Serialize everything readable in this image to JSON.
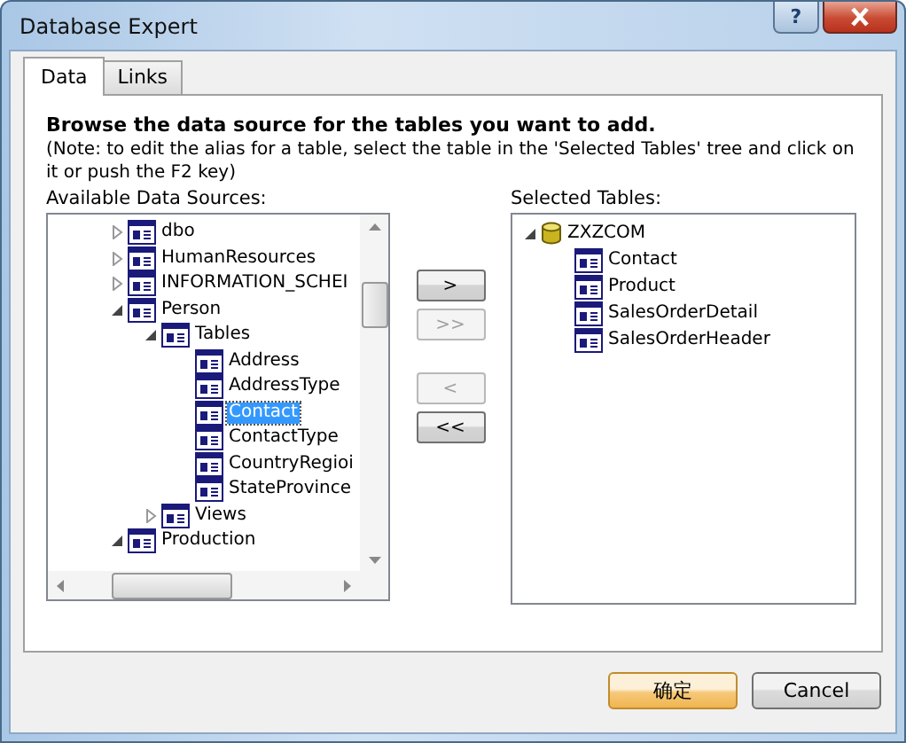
{
  "window": {
    "title": "Database Expert",
    "help": "?"
  },
  "tabs": [
    {
      "label": "Data",
      "selected": true
    },
    {
      "label": "Links",
      "selected": false
    }
  ],
  "heading": "Browse the data source for the tables you want to add.",
  "note": "(Note: to edit the alias for a table, select the table in the 'Selected Tables' tree and click on it or push the F2 key)",
  "available": {
    "label": "Available Data Sources:",
    "items": [
      {
        "label": "dbo",
        "kind": "table",
        "expanded": false,
        "selected": false
      },
      {
        "label": "HumanResources",
        "kind": "table",
        "expanded": false,
        "selected": false
      },
      {
        "label": "INFORMATION_SCHEI",
        "kind": "table",
        "expanded": false,
        "selected": false
      },
      {
        "label": "Person",
        "kind": "table",
        "expanded": true,
        "selected": false,
        "children": [
          {
            "label": "Tables",
            "kind": "table",
            "expanded": true,
            "selected": false,
            "children": [
              {
                "label": "Address",
                "kind": "table",
                "selected": false
              },
              {
                "label": "AddressType",
                "kind": "table",
                "selected": false
              },
              {
                "label": "Contact",
                "kind": "table",
                "selected": true
              },
              {
                "label": "ContactType",
                "kind": "table",
                "selected": false
              },
              {
                "label": "CountryRegioi",
                "kind": "table",
                "selected": false
              },
              {
                "label": "StateProvince",
                "kind": "table",
                "selected": false
              }
            ]
          },
          {
            "label": "Views",
            "kind": "table",
            "expanded": false,
            "selected": false
          }
        ]
      },
      {
        "label": "Production",
        "kind": "table",
        "expanded": true,
        "selected": false
      }
    ]
  },
  "transfer_buttons": [
    {
      "label": ">",
      "disabled": false
    },
    {
      "label": ">>",
      "disabled": true
    },
    {
      "label": "<",
      "disabled": true
    },
    {
      "label": "<<",
      "disabled": false
    }
  ],
  "selected": {
    "label": "Selected Tables:",
    "items": [
      {
        "label": "ZXZCOM",
        "kind": "database",
        "expanded": true,
        "selected": false,
        "children": [
          {
            "label": "Contact",
            "kind": "table",
            "selected": false
          },
          {
            "label": "Product",
            "kind": "table",
            "selected": false
          },
          {
            "label": "SalesOrderDetail",
            "kind": "table",
            "selected": false
          },
          {
            "label": "SalesOrderHeader",
            "kind": "table",
            "selected": false
          }
        ]
      }
    ]
  },
  "buttons": [
    {
      "label": "确定",
      "default": true
    },
    {
      "label": "Cancel",
      "default": false
    }
  ]
}
